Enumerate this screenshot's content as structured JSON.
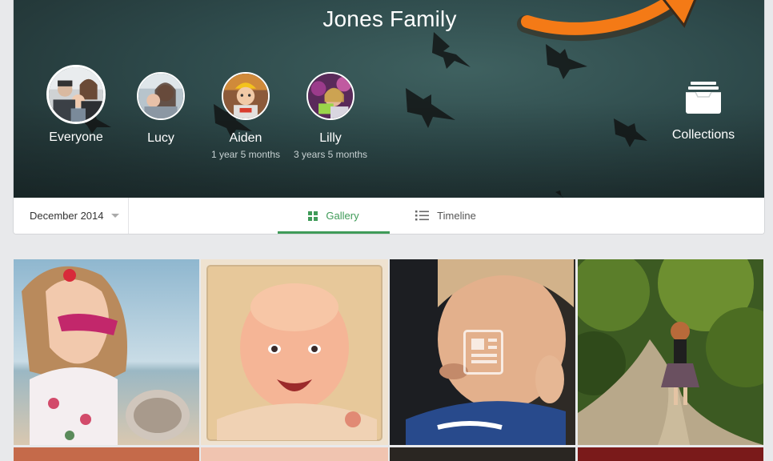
{
  "family": {
    "title": "Jones Family"
  },
  "members": [
    {
      "name": "Everyone",
      "age": "",
      "selected": true
    },
    {
      "name": "Lucy",
      "age": "",
      "selected": false
    },
    {
      "name": "Aiden",
      "age": "1 year 5 months",
      "selected": false
    },
    {
      "name": "Lilly",
      "age": "3 years 5 months",
      "selected": false
    }
  ],
  "collections": {
    "label": "Collections",
    "icon": "inbox-tray-icon"
  },
  "toolbar": {
    "date_value": "December 2014",
    "tabs": [
      {
        "label": "Gallery",
        "icon": "grid-icon",
        "active": true
      },
      {
        "label": "Timeline",
        "icon": "list-icon",
        "active": false
      }
    ]
  },
  "colors": {
    "accent": "#3f9b58",
    "hero": "#2e4a4b",
    "arrow": "#f47a16"
  },
  "gallery": {
    "photos": [
      {
        "subject": "girl-with-sunglasses"
      },
      {
        "subject": "laughing-baby"
      },
      {
        "subject": "toddler-smiling",
        "overlay_icon": "document-icon"
      },
      {
        "subject": "girl-on-path"
      }
    ]
  }
}
